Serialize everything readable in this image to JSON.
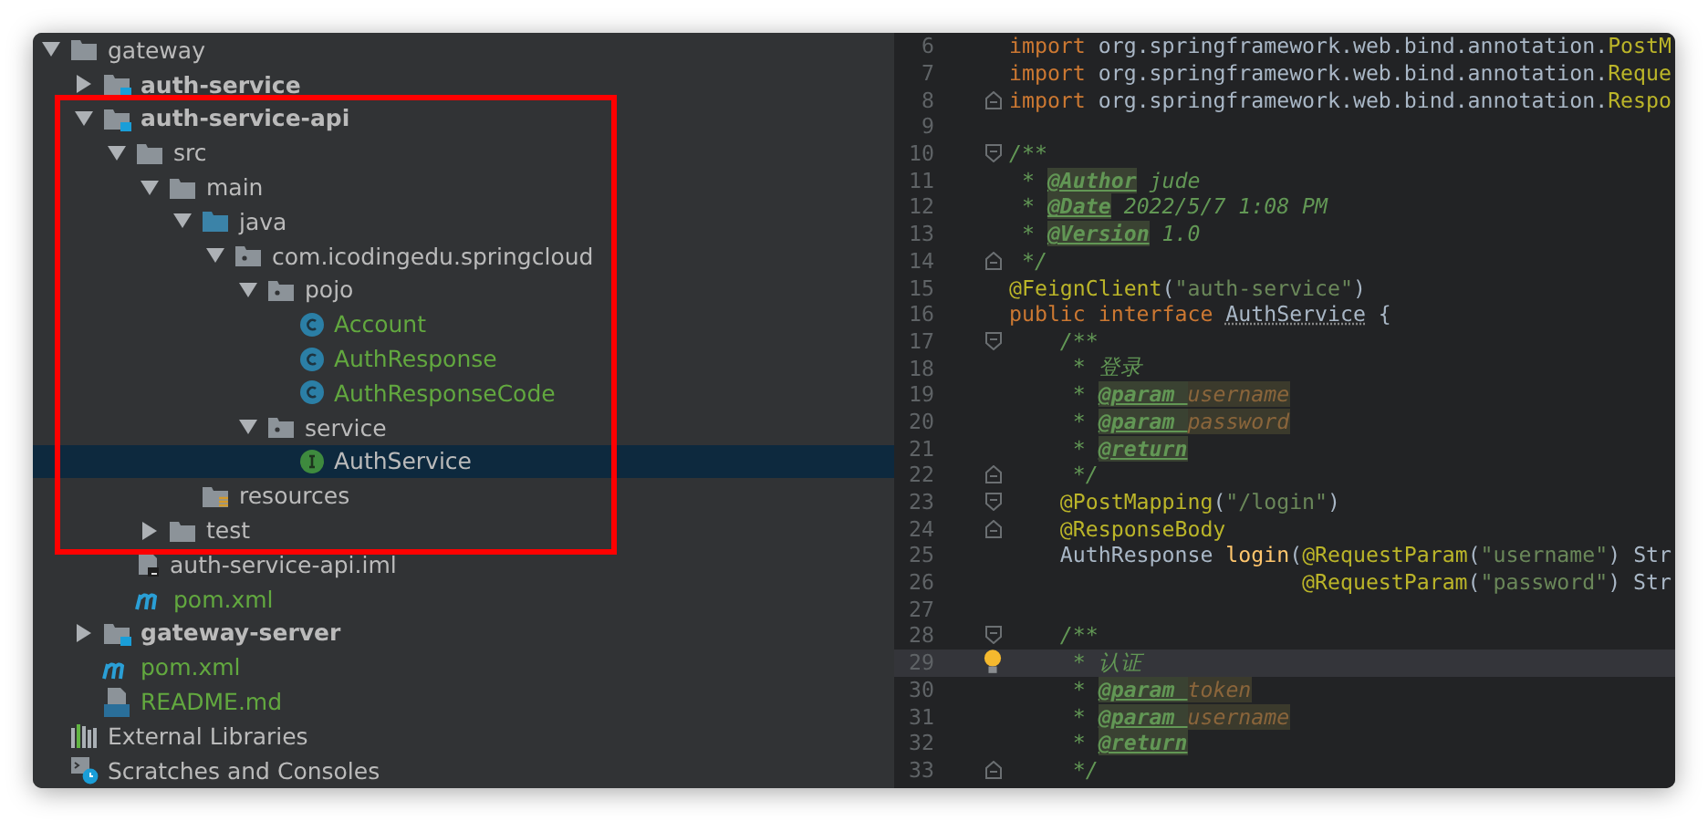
{
  "project_tree": [
    {
      "label": "gateway",
      "kind": "folder",
      "expanded": true,
      "children": [
        {
          "label": "auth-service",
          "kind": "module",
          "bold": true,
          "expanded": false
        },
        {
          "label": "auth-service-api",
          "kind": "module",
          "bold": true,
          "expanded": true,
          "children": [
            {
              "label": "src",
              "kind": "folder",
              "expanded": true,
              "children": [
                {
                  "label": "main",
                  "kind": "folder",
                  "expanded": true,
                  "children": [
                    {
                      "label": "java",
                      "kind": "source-folder",
                      "expanded": true,
                      "children": [
                        {
                          "label": "com.icodingedu.springcloud",
                          "kind": "package",
                          "expanded": true,
                          "children": [
                            {
                              "label": "pojo",
                              "kind": "package",
                              "expanded": true,
                              "children": [
                                {
                                  "label": "Account",
                                  "kind": "class",
                                  "added": true,
                                  "selected": false
                                },
                                {
                                  "label": "AuthResponse",
                                  "kind": "class",
                                  "added": true,
                                  "selected": false
                                },
                                {
                                  "label": "AuthResponseCode",
                                  "kind": "class",
                                  "added": true,
                                  "selected": false
                                }
                              ]
                            },
                            {
                              "label": "service",
                              "kind": "package",
                              "expanded": true,
                              "children": [
                                {
                                  "label": "AuthService",
                                  "kind": "interface",
                                  "added": false,
                                  "selected": true
                                }
                              ]
                            }
                          ]
                        }
                      ]
                    },
                    {
                      "label": "resources",
                      "kind": "resources-folder"
                    }
                  ]
                },
                {
                  "label": "test",
                  "kind": "folder",
                  "expanded": false
                }
              ]
            },
            {
              "label": "auth-service-api.iml",
              "kind": "iml",
              "added": false
            },
            {
              "label": "pom.xml",
              "kind": "maven",
              "added": true
            }
          ]
        },
        {
          "label": "gateway-server",
          "kind": "module",
          "bold": true,
          "expanded": false
        },
        {
          "label": "pom.xml",
          "kind": "maven",
          "added": true
        },
        {
          "label": "README.md",
          "kind": "markdown",
          "added": true
        }
      ]
    },
    {
      "label": "External Libraries",
      "kind": "libraries"
    },
    {
      "label": "Scratches and Consoles",
      "kind": "scratches"
    }
  ],
  "code_lines": [
    {
      "number": "6",
      "tokens": [
        {
          "kind": "keyword",
          "text": "import "
        },
        {
          "kind": "plain",
          "text": "org.springframework.web.bind.annotation."
        },
        {
          "kind": "annotation",
          "text": "PostM"
        }
      ]
    },
    {
      "number": "7",
      "tokens": [
        {
          "kind": "keyword",
          "text": "import "
        },
        {
          "kind": "plain",
          "text": "org.springframework.web.bind.annotation."
        },
        {
          "kind": "annotation",
          "text": "Reque"
        }
      ]
    },
    {
      "number": "8",
      "fold_end": true,
      "tokens": [
        {
          "kind": "keyword",
          "text": "import "
        },
        {
          "kind": "plain",
          "text": "org.springframework.web.bind.annotation."
        },
        {
          "kind": "annotation",
          "text": "Respo"
        }
      ]
    },
    {
      "number": "9"
    },
    {
      "number": "10",
      "fold_start": true,
      "tokens": [
        {
          "kind": "doc",
          "text": "/**"
        }
      ]
    },
    {
      "number": "11",
      "tokens": [
        {
          "kind": "doc",
          "text": " * "
        },
        {
          "kind": "doctag",
          "text": "@Author"
        },
        {
          "kind": "doc",
          "text": " jude"
        }
      ]
    },
    {
      "number": "12",
      "tokens": [
        {
          "kind": "doc",
          "text": " * "
        },
        {
          "kind": "doctag",
          "text": "@Date"
        },
        {
          "kind": "doc",
          "text": " 2022/5/7 1:08 PM"
        }
      ]
    },
    {
      "number": "13",
      "tokens": [
        {
          "kind": "doc",
          "text": " * "
        },
        {
          "kind": "doctag",
          "text": "@Version"
        },
        {
          "kind": "doc",
          "text": " 1.0"
        }
      ]
    },
    {
      "number": "14",
      "fold_end": true,
      "tokens": [
        {
          "kind": "doc",
          "text": " */"
        }
      ]
    },
    {
      "number": "15",
      "tokens": [
        {
          "kind": "annotation",
          "text": "@FeignClient"
        },
        {
          "kind": "plain",
          "text": "("
        },
        {
          "kind": "string",
          "text": "\"auth-service\""
        },
        {
          "kind": "plain",
          "text": ")"
        }
      ]
    },
    {
      "number": "16",
      "tokens": [
        {
          "kind": "keyword",
          "text": "public interface "
        },
        {
          "kind": "typeref",
          "text": "AuthService"
        },
        {
          "kind": "plain",
          "text": " {"
        }
      ]
    },
    {
      "number": "17",
      "fold_start": true,
      "tokens": [
        {
          "kind": "doc",
          "text": "    /**"
        }
      ]
    },
    {
      "number": "18",
      "tokens": [
        {
          "kind": "doc",
          "text": "     * 登录"
        }
      ]
    },
    {
      "number": "19",
      "tokens": [
        {
          "kind": "doc",
          "text": "     * "
        },
        {
          "kind": "doctag",
          "text": "@param "
        },
        {
          "kind": "docparam",
          "text": "username"
        }
      ]
    },
    {
      "number": "20",
      "tokens": [
        {
          "kind": "doc",
          "text": "     * "
        },
        {
          "kind": "doctag",
          "text": "@param "
        },
        {
          "kind": "docparam",
          "text": "password"
        }
      ]
    },
    {
      "number": "21",
      "tokens": [
        {
          "kind": "doc",
          "text": "     * "
        },
        {
          "kind": "doctag",
          "text": "@return"
        }
      ]
    },
    {
      "number": "22",
      "fold_end": true,
      "tokens": [
        {
          "kind": "doc",
          "text": "     */"
        }
      ]
    },
    {
      "number": "23",
      "fold_start": true,
      "tokens": [
        {
          "kind": "annotation",
          "text": "    @PostMapping"
        },
        {
          "kind": "plain",
          "text": "("
        },
        {
          "kind": "string",
          "text": "\"/login\""
        },
        {
          "kind": "plain",
          "text": ")"
        }
      ]
    },
    {
      "number": "24",
      "fold_end": true,
      "tokens": [
        {
          "kind": "annotation",
          "text": "    @ResponseBody"
        }
      ]
    },
    {
      "number": "25",
      "tokens": [
        {
          "kind": "plain",
          "text": "    AuthResponse "
        },
        {
          "kind": "method",
          "text": "login"
        },
        {
          "kind": "plain",
          "text": "("
        },
        {
          "kind": "annotation",
          "text": "@RequestParam"
        },
        {
          "kind": "plain",
          "text": "("
        },
        {
          "kind": "string",
          "text": "\"username\""
        },
        {
          "kind": "plain",
          "text": ") Str"
        }
      ]
    },
    {
      "number": "26",
      "tokens": [
        {
          "kind": "annotation",
          "text": "                       @RequestParam"
        },
        {
          "kind": "plain",
          "text": "("
        },
        {
          "kind": "string",
          "text": "\"password\""
        },
        {
          "kind": "plain",
          "text": ") Str"
        }
      ]
    },
    {
      "number": "27"
    },
    {
      "number": "28",
      "fold_start": true,
      "tokens": [
        {
          "kind": "doc",
          "text": "    /**"
        }
      ]
    },
    {
      "number": "29",
      "current": true,
      "bulb": true,
      "tokens": [
        {
          "kind": "doc",
          "text": "     * 认证"
        }
      ]
    },
    {
      "number": "30",
      "tokens": [
        {
          "kind": "doc",
          "text": "     * "
        },
        {
          "kind": "doctag",
          "text": "@param "
        },
        {
          "kind": "docparam",
          "text": "token"
        }
      ]
    },
    {
      "number": "31",
      "tokens": [
        {
          "kind": "doc",
          "text": "     * "
        },
        {
          "kind": "doctag",
          "text": "@param "
        },
        {
          "kind": "docparam",
          "text": "username"
        }
      ]
    },
    {
      "number": "32",
      "tokens": [
        {
          "kind": "doc",
          "text": "     * "
        },
        {
          "kind": "doctag",
          "text": "@return"
        }
      ]
    },
    {
      "number": "33",
      "fold_end": true,
      "tokens": [
        {
          "kind": "doc",
          "text": "     */"
        }
      ]
    }
  ]
}
